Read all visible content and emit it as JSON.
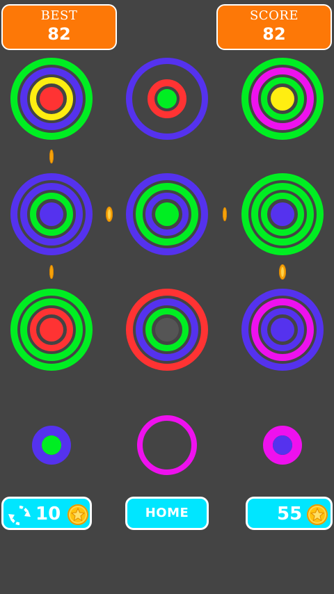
{
  "header": {
    "best_label": "BEST",
    "best_value": "82",
    "score_label": "SCORE",
    "score_value": "82"
  },
  "colors": {
    "background": "#444444",
    "green": "#00ee22",
    "blue": "#5532ee",
    "red": "#ff3333",
    "yellow": "#ffee11",
    "magenta": "#ee11ee",
    "gray": "#555555",
    "orange": "#fd7807",
    "cyan": "#00e6ff"
  },
  "board": {
    "stacks": [
      {
        "position": "row1-col1",
        "rings": [
          "green",
          "blue",
          "yellow",
          "red"
        ]
      },
      {
        "position": "row1-col2",
        "rings": [
          "blue",
          "red",
          "green"
        ]
      },
      {
        "position": "row1-col3",
        "rings": [
          "green",
          "magenta",
          "green",
          "yellow"
        ]
      },
      {
        "position": "row2-col1",
        "rings": [
          "blue",
          "blue",
          "green",
          "blue"
        ]
      },
      {
        "position": "row2-col2",
        "rings": [
          "blue",
          "green",
          "blue",
          "green"
        ]
      },
      {
        "position": "row2-col3",
        "rings": [
          "green",
          "green",
          "green",
          "blue"
        ]
      },
      {
        "position": "row3-col1",
        "rings": [
          "green",
          "green",
          "red",
          "red"
        ]
      },
      {
        "position": "row3-col2",
        "rings": [
          "red",
          "blue",
          "green",
          "gray"
        ]
      },
      {
        "position": "row3-col3",
        "rings": [
          "blue",
          "magenta",
          "blue",
          "blue"
        ]
      }
    ],
    "pieces": [
      {
        "slot": "left",
        "rings": [
          "blue",
          "green"
        ]
      },
      {
        "slot": "center",
        "rings": [
          "magenta"
        ]
      },
      {
        "slot": "right",
        "rings": [
          "magenta",
          "blue"
        ]
      }
    ]
  },
  "footer": {
    "restart_count": "10",
    "home_label": "HOME",
    "coins_count": "55"
  },
  "icons": {
    "restart": "restart-icon",
    "coin": "star-coin-icon"
  }
}
